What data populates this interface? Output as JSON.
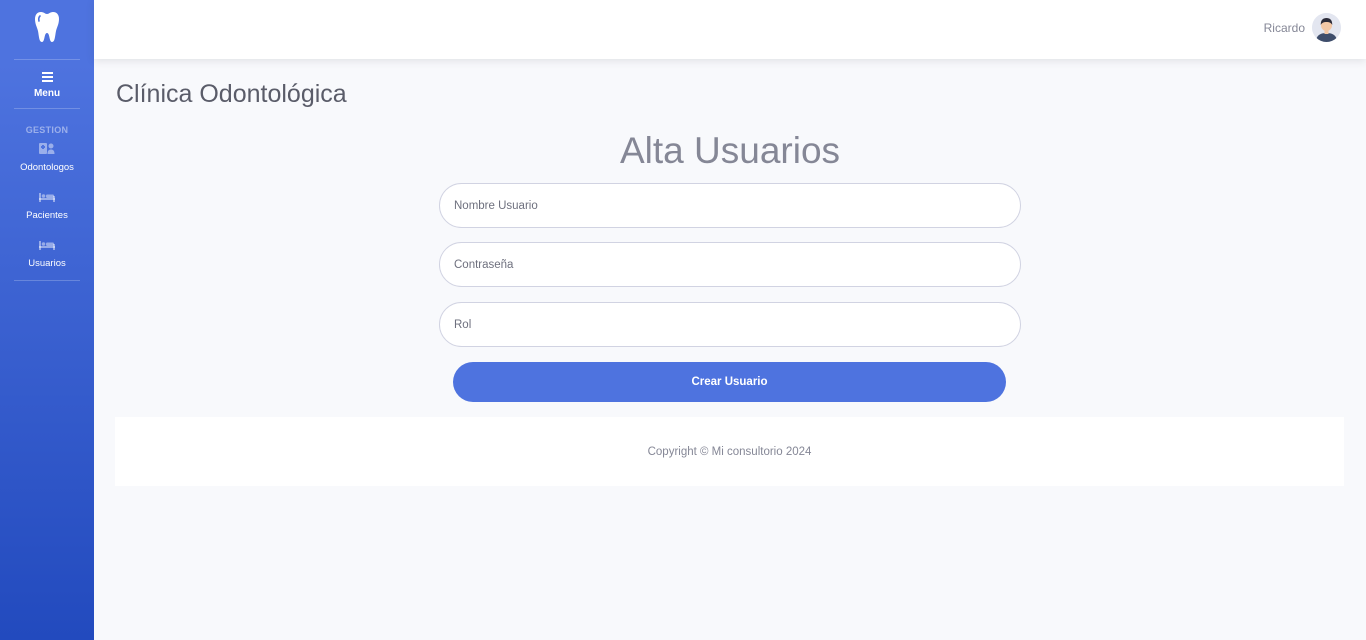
{
  "sidebar": {
    "brand_icon": "tooth-icon",
    "menu_label": "Menu",
    "heading": "GESTION",
    "items": [
      {
        "label": "Odontologos",
        "icon": "hospital-user-icon"
      },
      {
        "label": "Pacientes",
        "icon": "bed-icon"
      },
      {
        "label": "Usuarios",
        "icon": "bed-icon"
      }
    ]
  },
  "topbar": {
    "user_name": "Ricardo"
  },
  "main": {
    "page_title": "Clínica Odontológica",
    "form_title": "Alta Usuarios",
    "fields": {
      "username_placeholder": "Nombre Usuario",
      "password_placeholder": "Contraseña",
      "role_placeholder": "Rol"
    },
    "submit_label": "Crear Usuario"
  },
  "footer": {
    "copyright": "Copyright © Mi consultorio 2024"
  },
  "colors": {
    "primary": "#4e73df",
    "primary_dark": "#224abe",
    "background": "#f8f9fc",
    "text_muted": "#858796"
  }
}
